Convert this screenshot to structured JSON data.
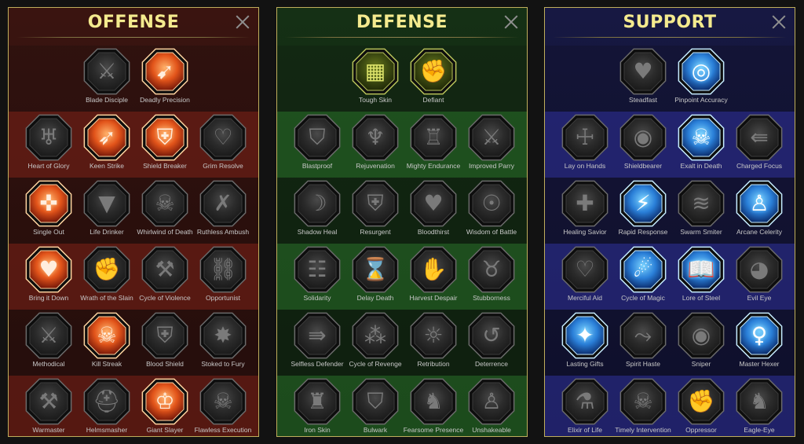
{
  "colors": {
    "title": "#f4ea8e",
    "offense_active": "#ff6a2c",
    "defense_active": "#a7b62c",
    "support_active": "#3aa8ff",
    "locked": "#3a3a3a"
  },
  "panels": [
    {
      "id": "offense",
      "title": "OFFENSE",
      "rows": [
        [
          {
            "label": "Blade Disciple",
            "icon": "crossed-swords-icon",
            "glyph": "⚔",
            "state": "locked"
          },
          {
            "label": "Deadly Precision",
            "icon": "piercing-blade-icon",
            "glyph": "➹",
            "state": "active"
          }
        ],
        [
          {
            "label": "Heart of Glory",
            "icon": "horned-warrior-icon",
            "glyph": "♅",
            "state": "locked"
          },
          {
            "label": "Keen Strike",
            "icon": "keen-strike-icon",
            "glyph": "➶",
            "state": "active"
          },
          {
            "label": "Shield Breaker",
            "icon": "shattered-shield-icon",
            "glyph": "⛨",
            "state": "active"
          },
          {
            "label": "Grim Resolve",
            "icon": "pierced-heart-icon",
            "glyph": "♡",
            "state": "locked"
          }
        ],
        [
          {
            "label": "Single Out",
            "icon": "targeted-figure-icon",
            "glyph": "✜",
            "state": "active"
          },
          {
            "label": "Life Drinker",
            "icon": "fanged-maw-icon",
            "glyph": "▼",
            "state": "locked"
          },
          {
            "label": "Whirlwind of Death",
            "icon": "skull-whirl-icon",
            "glyph": "☠",
            "state": "locked"
          },
          {
            "label": "Ruthless Ambush",
            "icon": "dagger-strike-icon",
            "glyph": "✗",
            "state": "locked"
          }
        ],
        [
          {
            "label": "Bring it Down",
            "icon": "falling-sword-icon",
            "glyph": "♥",
            "state": "active"
          },
          {
            "label": "Wrath of the Slain",
            "icon": "raised-fist-icon",
            "glyph": "✊",
            "state": "locked"
          },
          {
            "label": "Cycle of Violence",
            "icon": "axe-icon",
            "glyph": "⚒",
            "state": "locked"
          },
          {
            "label": "Opportunist",
            "icon": "chained-figure-icon",
            "glyph": "⛓",
            "state": "locked"
          }
        ],
        [
          {
            "label": "Methodical",
            "icon": "sword-circle-icon",
            "glyph": "⚔",
            "state": "locked"
          },
          {
            "label": "Kill Streak",
            "icon": "twin-skulls-icon",
            "glyph": "☠",
            "state": "active"
          },
          {
            "label": "Blood Shield",
            "icon": "blood-shield-icon",
            "glyph": "⛨",
            "state": "locked"
          },
          {
            "label": "Stoked to Fury",
            "icon": "furious-figure-icon",
            "glyph": "✸",
            "state": "locked"
          }
        ],
        [
          {
            "label": "Warmaster",
            "icon": "warhammer-icon",
            "glyph": "⚒",
            "state": "locked"
          },
          {
            "label": "Helmsmasher",
            "icon": "helmet-icon",
            "glyph": "⛑",
            "state": "locked"
          },
          {
            "label": "Giant Slayer",
            "icon": "giant-icon",
            "glyph": "♔",
            "state": "active"
          },
          {
            "label": "Flawless Execution",
            "icon": "skull-blades-icon",
            "glyph": "☠",
            "state": "locked"
          }
        ]
      ]
    },
    {
      "id": "defense",
      "title": "DEFENSE",
      "rows": [
        [
          {
            "label": "Tough Skin",
            "icon": "armor-plates-icon",
            "glyph": "▦",
            "state": "active"
          },
          {
            "label": "Defiant",
            "icon": "defiant-fist-icon",
            "glyph": "✊",
            "state": "active"
          }
        ],
        [
          {
            "label": "Blastproof",
            "icon": "layered-shield-icon",
            "glyph": "⛉",
            "state": "locked"
          },
          {
            "label": "Rejuvenation",
            "icon": "rejuvenation-figure-icon",
            "glyph": "♆",
            "state": "locked"
          },
          {
            "label": "Mighty Endurance",
            "icon": "strong-body-icon",
            "glyph": "♖",
            "state": "locked"
          },
          {
            "label": "Improved Parry",
            "icon": "parry-blades-icon",
            "glyph": "⚔",
            "state": "locked"
          }
        ],
        [
          {
            "label": "Shadow Heal",
            "icon": "shadow-figure-icon",
            "glyph": "☽",
            "state": "locked"
          },
          {
            "label": "Resurgent",
            "icon": "sword-shield-icon",
            "glyph": "⛨",
            "state": "locked"
          },
          {
            "label": "Bloodthirst",
            "icon": "skull-heart-icon",
            "glyph": "♥",
            "state": "locked"
          },
          {
            "label": "Wisdom of Battle",
            "icon": "sage-head-icon",
            "glyph": "☉",
            "state": "locked"
          }
        ],
        [
          {
            "label": "Solidarity",
            "icon": "raised-hands-icon",
            "glyph": "☷",
            "state": "locked"
          },
          {
            "label": "Delay Death",
            "icon": "hourglass-icon",
            "glyph": "⌛",
            "state": "locked"
          },
          {
            "label": "Harvest Despair",
            "icon": "open-hand-icon",
            "glyph": "✋",
            "state": "locked"
          },
          {
            "label": "Stubborness",
            "icon": "bull-head-icon",
            "glyph": "♉",
            "state": "locked"
          }
        ],
        [
          {
            "label": "Selfless Defender",
            "icon": "guarding-figure-icon",
            "glyph": "⇛",
            "state": "locked"
          },
          {
            "label": "Cycle of Revenge",
            "icon": "drops-icon",
            "glyph": "⁂",
            "state": "locked"
          },
          {
            "label": "Retribution",
            "icon": "spiked-skull-icon",
            "glyph": "☼",
            "state": "locked"
          },
          {
            "label": "Deterrence",
            "icon": "deflect-sword-icon",
            "glyph": "↺",
            "state": "locked"
          }
        ],
        [
          {
            "label": "Iron Skin",
            "icon": "armored-knight-icon",
            "glyph": "♜",
            "state": "locked"
          },
          {
            "label": "Bulwark",
            "icon": "bulwark-shield-icon",
            "glyph": "⛉",
            "state": "locked"
          },
          {
            "label": "Fearsome Presence",
            "icon": "fearsome-warrior-icon",
            "glyph": "♞",
            "state": "locked"
          },
          {
            "label": "Unshakeable",
            "icon": "sturdy-figure-icon",
            "glyph": "♙",
            "state": "locked"
          }
        ]
      ]
    },
    {
      "id": "support",
      "title": "SUPPORT",
      "rows": [
        [
          {
            "label": "Steadfast",
            "icon": "heart-plus-icon",
            "glyph": "♥",
            "state": "locked"
          },
          {
            "label": "Pinpoint Accuracy",
            "icon": "target-strike-icon",
            "glyph": "◎",
            "state": "active"
          }
        ],
        [
          {
            "label": "Lay on Hands",
            "icon": "praying-hands-icon",
            "glyph": "☩",
            "state": "locked"
          },
          {
            "label": "Shieldbearer",
            "icon": "radiant-shield-icon",
            "glyph": "◉",
            "state": "locked"
          },
          {
            "label": "Exalt in Death",
            "icon": "flaming-skull-icon",
            "glyph": "☠",
            "state": "active"
          },
          {
            "label": "Charged Focus",
            "icon": "charging-fist-icon",
            "glyph": "⇚",
            "state": "locked"
          }
        ],
        [
          {
            "label": "Healing Savior",
            "icon": "healing-figure-icon",
            "glyph": "✚",
            "state": "locked"
          },
          {
            "label": "Rapid Response",
            "icon": "lightning-icon",
            "glyph": "⚡",
            "state": "active"
          },
          {
            "label": "Swarm Smiter",
            "icon": "zigzag-icon",
            "glyph": "≋",
            "state": "locked"
          },
          {
            "label": "Arcane Celerity",
            "icon": "speeding-figure-icon",
            "glyph": "♙",
            "state": "active"
          }
        ],
        [
          {
            "label": "Merciful Aid",
            "icon": "chained-heart-icon",
            "glyph": "♡",
            "state": "locked"
          },
          {
            "label": "Cycle of Magic",
            "icon": "comet-icon",
            "glyph": "☄",
            "state": "active"
          },
          {
            "label": "Lore of Steel",
            "icon": "open-book-icon",
            "glyph": "📖",
            "state": "active"
          },
          {
            "label": "Evil Eye",
            "icon": "evil-eyes-icon",
            "glyph": "◕",
            "state": "locked"
          }
        ],
        [
          {
            "label": "Lasting Gifts",
            "icon": "star-compass-icon",
            "glyph": "✦",
            "state": "active"
          },
          {
            "label": "Spirit Haste",
            "icon": "winged-boot-icon",
            "glyph": "⤳",
            "state": "locked"
          },
          {
            "label": "Sniper",
            "icon": "eye-icon",
            "glyph": "◉",
            "state": "locked"
          },
          {
            "label": "Master Hexer",
            "icon": "voodoo-doll-icon",
            "glyph": "♀",
            "state": "active"
          }
        ],
        [
          {
            "label": "Elixir of Life",
            "icon": "potion-flask-icon",
            "glyph": "⚗",
            "state": "locked"
          },
          {
            "label": "Timely Intervention",
            "icon": "skull-banner-icon",
            "glyph": "☠",
            "state": "locked"
          },
          {
            "label": "Oppressor",
            "icon": "crushing-hand-icon",
            "glyph": "✊",
            "state": "locked"
          },
          {
            "label": "Eagle-Eye",
            "icon": "eagle-head-icon",
            "glyph": "♞",
            "state": "locked"
          }
        ]
      ]
    }
  ]
}
